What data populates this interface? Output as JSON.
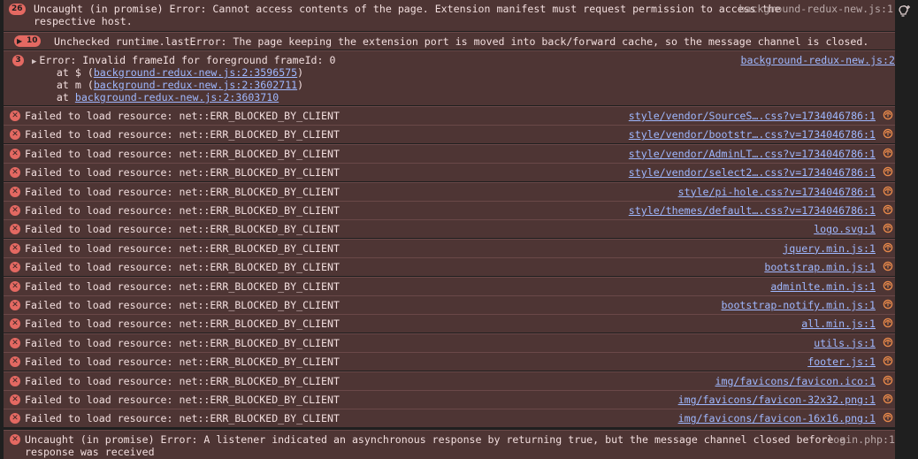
{
  "colors": {
    "row_bg": "#4e3534",
    "error_red": "#e46962",
    "link": "#9fb8ff"
  },
  "messages": [
    {
      "badge": "26",
      "text_l1": "Uncaught (in promise) Error: Cannot access contents of the page. Extension manifest must request permission to access the",
      "text_l2": "respective host.",
      "source": "background-redux-new.js:1"
    },
    {
      "badge": "10",
      "text": "Unchecked runtime.lastError: The page keeping the extension port is moved into back/forward cache, so the message channel is closed."
    },
    {
      "badge": "3",
      "text": "Error: Invalid frameId for foreground frameId: 0",
      "source": "background-redux-new.js:2",
      "stack": [
        {
          "prefix": "    at $ (",
          "link": "background-redux-new.js:2:3596575",
          "suffix": ")"
        },
        {
          "prefix": "    at m (",
          "link": "background-redux-new.js:2:3602711",
          "suffix": ")"
        },
        {
          "prefix": "    at ",
          "link": "background-redux-new.js:2:3603710",
          "suffix": ""
        }
      ]
    }
  ],
  "blocked_text": "Failed to load resource: net::ERR_BLOCKED_BY_CLIENT",
  "blocked_sources": [
    "style/vendor/SourceS….css?v=1734046786:1",
    "style/vendor/bootstr….css?v=1734046786:1",
    "style/vendor/AdminLT….css?v=1734046786:1",
    "style/vendor/select2….css?v=1734046786:1",
    "style/pi-hole.css?v=1734046786:1",
    "style/themes/default….css?v=1734046786:1",
    "logo.svg:1",
    "jquery.min.js:1",
    "bootstrap.min.js:1",
    "adminlte.min.js:1",
    "bootstrap-notify.min.js:1",
    "all.min.js:1",
    "utils.js:1",
    "footer.js:1",
    "img/favicons/favicon.ico:1",
    "img/favicons/favicon-32x32.png:1",
    "img/favicons/favicon-16x16.png:1"
  ],
  "last": {
    "text_l1": "Uncaught (in promise) Error: A listener indicated an asynchronous response by returning true, but the message channel closed before a",
    "text_l2": "response was received",
    "source": "login.php:1"
  }
}
